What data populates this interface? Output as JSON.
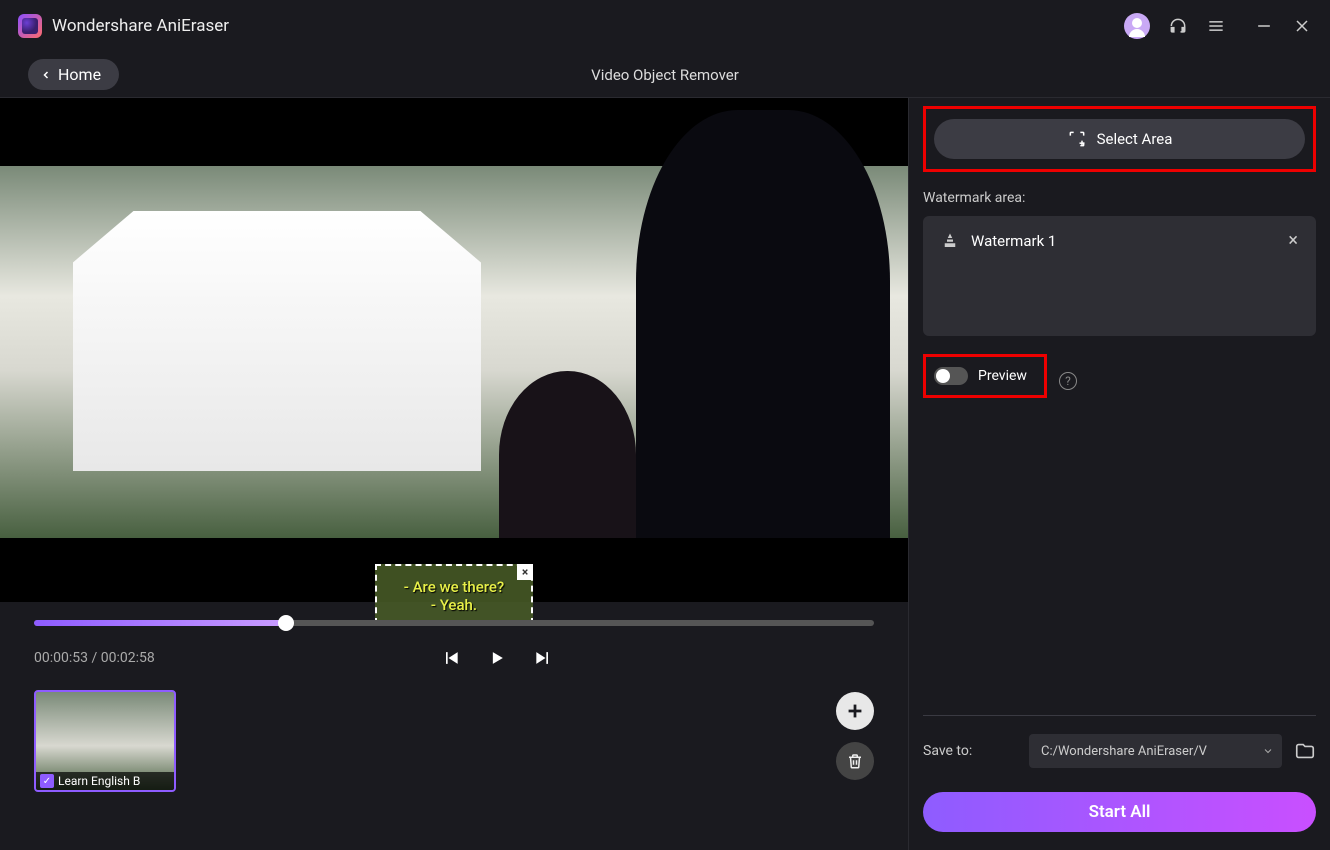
{
  "app": {
    "title": "Wondershare AniEraser"
  },
  "header": {
    "home": "Home",
    "page_title": "Video Object Remover"
  },
  "video": {
    "subtitle_line1": "- Are we there?",
    "subtitle_line2": "- Yeah."
  },
  "playback": {
    "current": "00:00:53",
    "total": "00:02:58",
    "sep": " / "
  },
  "thumbnail": {
    "label": "Learn English B"
  },
  "sidebar": {
    "select_area": "Select Area",
    "watermark_label": "Watermark area:",
    "items": [
      {
        "name": "Watermark 1"
      }
    ],
    "preview_label": "Preview",
    "save_label": "Save to:",
    "save_path": "C:/Wondershare AniEraser/V",
    "start_button": "Start All"
  }
}
